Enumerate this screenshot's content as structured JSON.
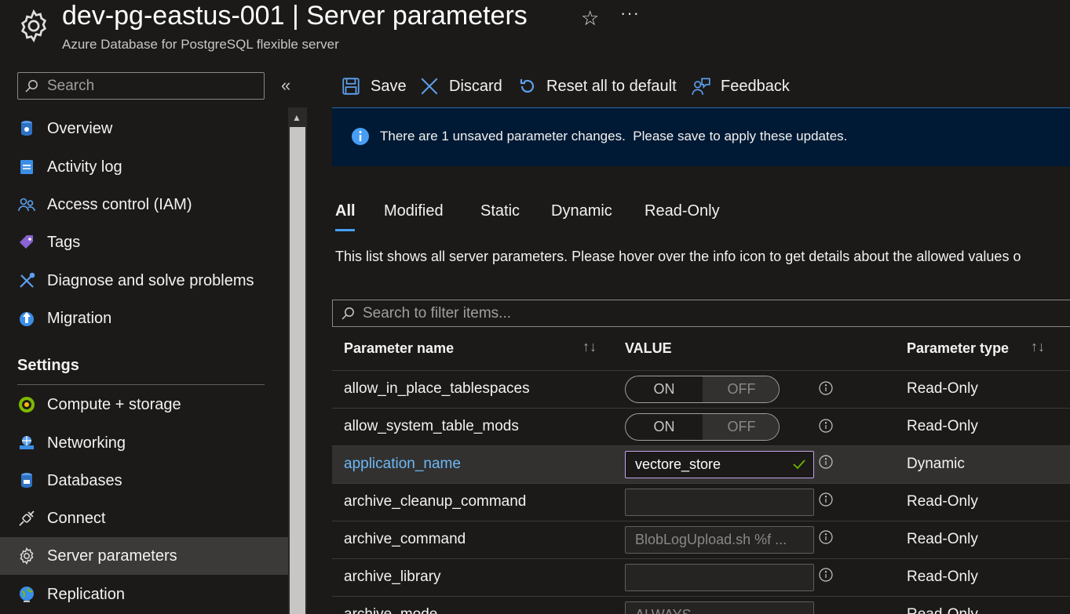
{
  "header": {
    "title": "dev-pg-eastus-001 | Server parameters",
    "subtitle": "Azure Database for PostgreSQL flexible server",
    "favorite_icon": "star-icon",
    "more_icon": "ellipsis-icon"
  },
  "sidebar": {
    "search_placeholder": "Search",
    "collapse_glyph": "«",
    "items": [
      {
        "label": "Overview",
        "icon": "database-icon"
      },
      {
        "label": "Activity log",
        "icon": "log-icon"
      },
      {
        "label": "Access control (IAM)",
        "icon": "people-icon"
      },
      {
        "label": "Tags",
        "icon": "tag-icon"
      },
      {
        "label": "Diagnose and solve problems",
        "icon": "wrench-icon"
      },
      {
        "label": "Migration",
        "icon": "migration-icon"
      }
    ],
    "settings_header": "Settings",
    "settings_items": [
      {
        "label": "Compute + storage",
        "icon": "compute-icon"
      },
      {
        "label": "Networking",
        "icon": "network-icon"
      },
      {
        "label": "Databases",
        "icon": "db-icon"
      },
      {
        "label": "Connect",
        "icon": "plug-icon"
      },
      {
        "label": "Server parameters",
        "icon": "gear-icon",
        "active": true
      },
      {
        "label": "Replication",
        "icon": "globe-icon"
      }
    ]
  },
  "toolbar": {
    "save": "Save",
    "discard": "Discard",
    "reset": "Reset all to default",
    "feedback": "Feedback"
  },
  "banner": {
    "text": "There are 1 unsaved parameter changes.  Please save to apply these updates."
  },
  "tabs": [
    "All",
    "Modified",
    "Static",
    "Dynamic",
    "Read-Only"
  ],
  "active_tab": "All",
  "description": "This list shows all server parameters. Please hover over the info icon to get details about the allowed values o",
  "filter_placeholder": "Search to filter items...",
  "table": {
    "columns": [
      "Parameter name",
      "VALUE",
      "Parameter type"
    ],
    "toggle_on": "ON",
    "toggle_off": "OFF",
    "rows": [
      {
        "name": "allow_in_place_tablespaces",
        "kind": "toggle",
        "value": "OFF",
        "type": "Read-Only"
      },
      {
        "name": "allow_system_table_mods",
        "kind": "toggle",
        "value": "OFF",
        "type": "Read-Only"
      },
      {
        "name": "application_name",
        "kind": "text",
        "value": "vectore_store",
        "type": "Dynamic",
        "selected": true
      },
      {
        "name": "archive_cleanup_command",
        "kind": "text",
        "value": "",
        "type": "Read-Only"
      },
      {
        "name": "archive_command",
        "kind": "text",
        "value": "BlobLogUpload.sh %f ...",
        "type": "Read-Only"
      },
      {
        "name": "archive_library",
        "kind": "text",
        "value": "",
        "type": "Read-Only"
      },
      {
        "name": "archive_mode",
        "kind": "select",
        "value": "ALWAYS",
        "type": "Read-Only"
      }
    ]
  },
  "colors": {
    "accent": "#479ef5",
    "banner_bg": "#001a35",
    "selected_link": "#6cb8f6",
    "edit_border": "#c4a3e8"
  }
}
